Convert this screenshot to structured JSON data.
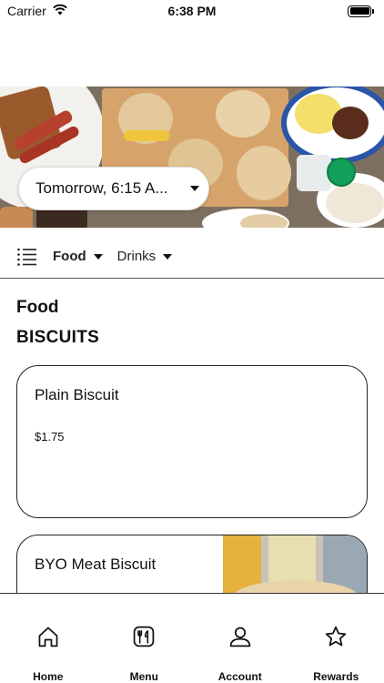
{
  "status_bar": {
    "carrier": "Carrier",
    "time": "6:38 PM"
  },
  "order_time": {
    "label": "Tomorrow, 6:15 A..."
  },
  "category_tabs": [
    {
      "label": "Food",
      "active": true
    },
    {
      "label": "Drinks",
      "active": false
    }
  ],
  "menu": {
    "section_title": "Food",
    "category_title": "BISCUITS",
    "items": [
      {
        "name": "Plain Biscuit",
        "price": "$1.75"
      },
      {
        "name": "BYO Meat Biscuit"
      }
    ]
  },
  "bottom_nav": [
    {
      "label": "Home",
      "icon": "home-icon"
    },
    {
      "label": "Menu",
      "icon": "menu-utensils-icon"
    },
    {
      "label": "Account",
      "icon": "account-icon"
    },
    {
      "label": "Rewards",
      "icon": "star-icon"
    }
  ],
  "colors": {
    "accent_green": "#12a05a",
    "text": "#111111",
    "border": "#222222"
  }
}
